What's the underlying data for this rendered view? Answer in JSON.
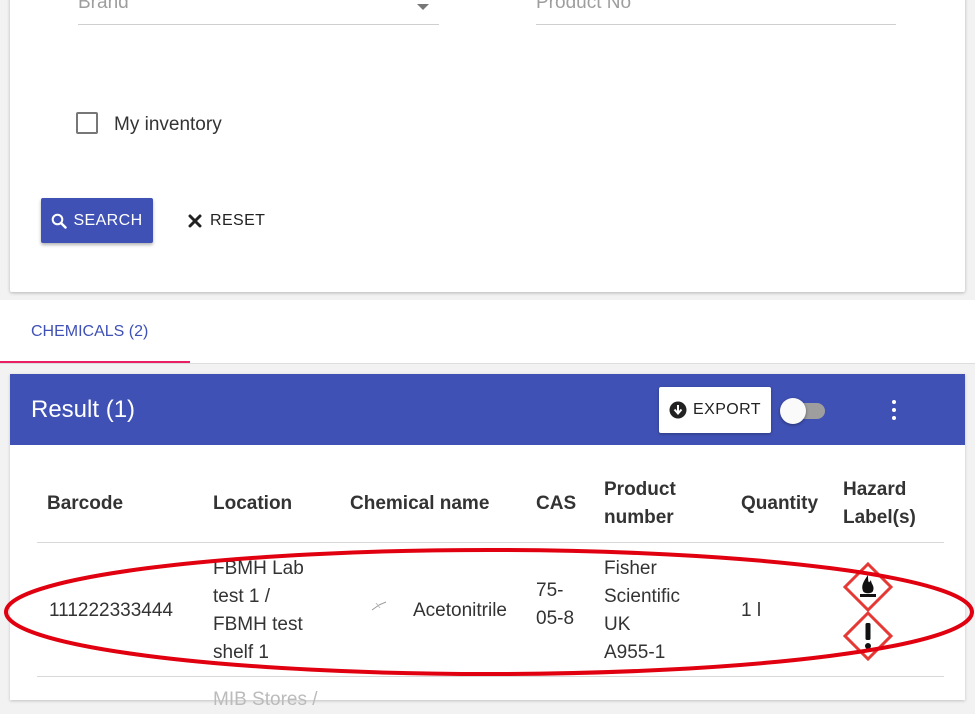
{
  "filters": {
    "brand_placeholder": "Brand",
    "product_no_placeholder": "Product No",
    "my_inventory_label": "My inventory",
    "search_label": "SEARCH",
    "reset_label": "RESET"
  },
  "tabs": [
    {
      "label": "CHEMICALS (2)",
      "active": true
    }
  ],
  "results": {
    "title": "Result (1)",
    "export_label": "EXPORT",
    "columns": [
      "Barcode",
      "Location",
      "Chemical name",
      "CAS",
      "Product number",
      "Quantity",
      "Hazard Label(s)"
    ],
    "rows": [
      {
        "barcode": "111222333444",
        "location_lines": [
          "FBMH Lab",
          "test 1 /",
          "FBMH test",
          "shelf 1"
        ],
        "chemical_name": "Acetonitrile",
        "cas_lines": [
          "75-",
          "05-8"
        ],
        "product_lines": [
          "Fisher",
          "Scientific",
          "UK",
          "A955-1"
        ],
        "quantity": "1 l",
        "hazards": [
          "flame-icon",
          "exclamation-icon"
        ]
      }
    ],
    "partial_row_text": "MIB Stores /"
  },
  "colors": {
    "primary": "#3f51b5",
    "tab_indicator": "#e91e63",
    "hazard": "#e53935",
    "annotation": "#e0000f"
  }
}
